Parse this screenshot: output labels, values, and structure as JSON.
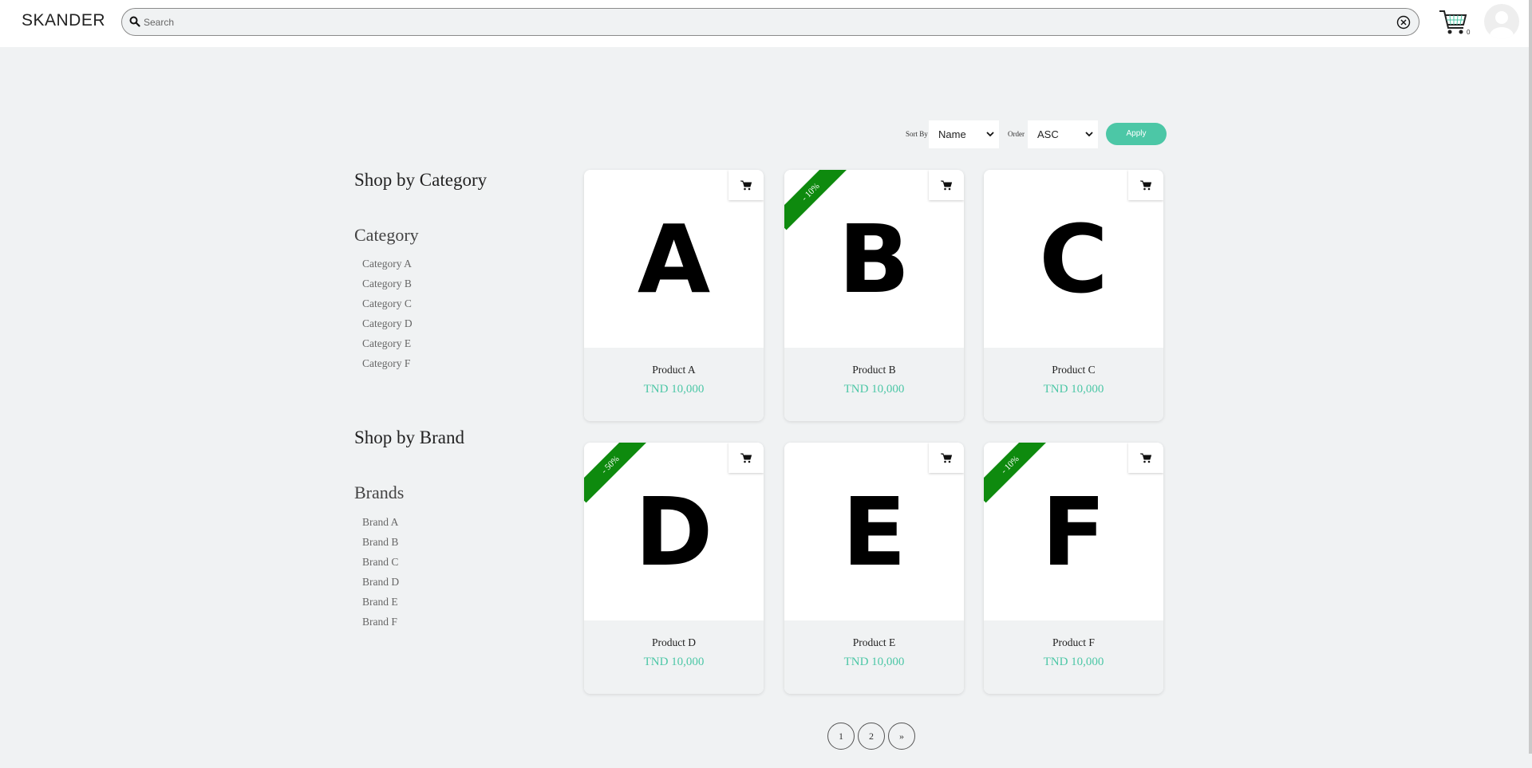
{
  "header": {
    "logo": "SKANDER",
    "search_placeholder": "Search",
    "cart_count": "0"
  },
  "sort": {
    "sort_by_label": "Sort By",
    "sort_by_value": "Name",
    "order_label": "Order",
    "order_value": "ASC",
    "apply_label": "Apply"
  },
  "sidebar": {
    "category_heading": "Shop by Category",
    "category_subheading": "Category",
    "categories": [
      "Category A",
      "Category B",
      "Category C",
      "Category D",
      "Category E",
      "Category F"
    ],
    "brand_heading": "Shop by Brand",
    "brand_subheading": "Brands",
    "brands": [
      "Brand A",
      "Brand B",
      "Brand C",
      "Brand D",
      "Brand E",
      "Brand F"
    ]
  },
  "products": [
    {
      "letter": "A",
      "name": "Product A",
      "price": "TND 10,000",
      "discount": ""
    },
    {
      "letter": "B",
      "name": "Product B",
      "price": "TND 10,000",
      "discount": "- 10%"
    },
    {
      "letter": "C",
      "name": "Product C",
      "price": "TND 10,000",
      "discount": ""
    },
    {
      "letter": "D",
      "name": "Product D",
      "price": "TND 10,000",
      "discount": "- 50%"
    },
    {
      "letter": "E",
      "name": "Product E",
      "price": "TND 10,000",
      "discount": ""
    },
    {
      "letter": "F",
      "name": "Product F",
      "price": "TND 10,000",
      "discount": "- 10%"
    }
  ],
  "pagination": [
    "1",
    "2",
    "»"
  ],
  "colors": {
    "accent": "#4cc7a6",
    "ribbon": "#0e8a0e",
    "background": "#f0f2f3"
  },
  "icons": {
    "search": "search-icon",
    "clear": "clear-circle-icon",
    "cart": "shopping-cart-icon",
    "avatar": "user-avatar-icon",
    "add_to_cart": "add-to-cart-icon"
  }
}
